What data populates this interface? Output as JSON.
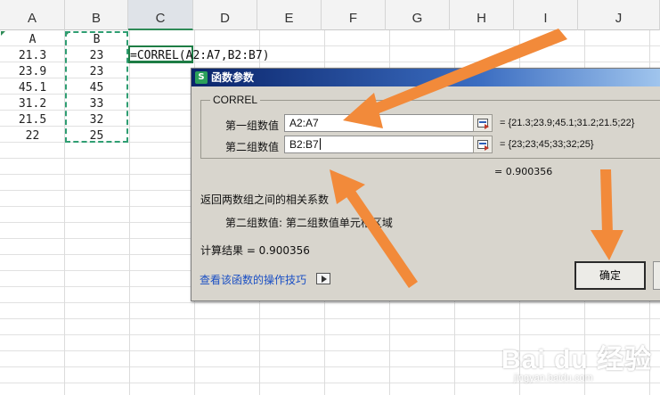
{
  "columns": [
    "A",
    "B",
    "C",
    "D",
    "E",
    "F",
    "G",
    "H",
    "I",
    "J"
  ],
  "sheet": {
    "headers": {
      "a": "A",
      "b": "B"
    },
    "rows": [
      {
        "a": "21.3",
        "b": "23"
      },
      {
        "a": "23.9",
        "b": "23"
      },
      {
        "a": "45.1",
        "b": "45"
      },
      {
        "a": "31.2",
        "b": "33"
      },
      {
        "a": "21.5",
        "b": "32"
      },
      {
        "a": "22",
        "b": "25"
      }
    ],
    "formula": "=CORREL(A2:A7,B2:B7)"
  },
  "dialog": {
    "title": "函数参数",
    "title_icon": "S",
    "function_name": "CORREL",
    "arg1": {
      "label": "第一组数值",
      "value": "A2:A7",
      "result": "= {21.3;23.9;45.1;31.2;21.5;22}"
    },
    "arg2": {
      "label": "第二组数值",
      "value": "B2:B7",
      "result": "= {23;23;45;33;32;25}"
    },
    "result_inline": "= 0.900356",
    "description": "返回两数组之间的相关系数",
    "param_help": "第二组数值:  第二组数值单元格区域",
    "calc_result": "计算结果 =  0.900356",
    "help_link": "查看该函数的操作技巧",
    "ok_label": "确定"
  },
  "annotation": {
    "arrow_color": "#f28a3a"
  },
  "watermark": {
    "logo": "Bai du 经验",
    "url": "jingyan.baidu.com"
  }
}
